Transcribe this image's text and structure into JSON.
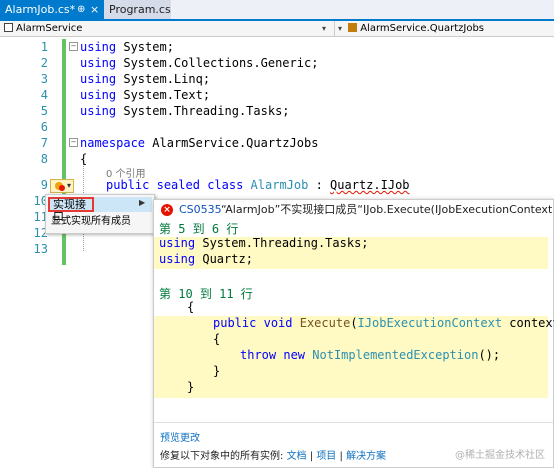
{
  "tabs": {
    "active": {
      "label": "AlarmJob.cs*",
      "pin": "⊕",
      "close": "×"
    },
    "inactive": {
      "label": "Program.cs"
    }
  },
  "navbar": {
    "left": "AlarmService",
    "right": "AlarmService.QuartzJobs"
  },
  "gutter": [
    "1",
    "2",
    "3",
    "4",
    "5",
    "6",
    "7",
    "8",
    "9",
    "10",
    "11",
    "12",
    "13"
  ],
  "code": {
    "using": "using",
    "ns_kw": "namespace",
    "ns_name": "AlarmService.QuartzJobs",
    "usings": [
      "System;",
      "System.Collections.Generic;",
      "System.Linq;",
      "System.Text;",
      "System.Threading.Tasks;"
    ],
    "brace_open": "{",
    "refs": "0 个引用",
    "public": "public",
    "sealed": "sealed",
    "class": "class",
    "class_name": "AlarmJob",
    "colon": ":",
    "base": "Quartz.IJob"
  },
  "quick_actions": {
    "items": [
      "实现接口",
      "显式实现所有成员"
    ],
    "submenu_arrow": "▶"
  },
  "preview": {
    "error_code": "CS0535",
    "error_text": "“AlarmJob”不实现接口成员“IJob.Execute(IJobExecutionContext)”",
    "section1_header": "第 5 到 6 行",
    "section1_lines": [
      "System.Threading.Tasks;",
      "Quartz;"
    ],
    "section2_header": "第 10 到 11 行",
    "brace_open": "{",
    "brace_close": "}",
    "method_public": "public",
    "method_void": "void",
    "method_name": "Execute",
    "method_param_type": "IJobExecutionContext",
    "method_param": "context)",
    "throw_kw": "throw",
    "new_kw": "new",
    "exception": "NotImplementedException",
    "exception_tail": "();",
    "preview_changes": "预览更改",
    "fix_all_prefix": "修复以下对象中的所有实例:",
    "fix_all_links": [
      "文档",
      "项目",
      "解决方案"
    ],
    "sep": "|"
  },
  "watermark": "@稀土掘金技术社区"
}
